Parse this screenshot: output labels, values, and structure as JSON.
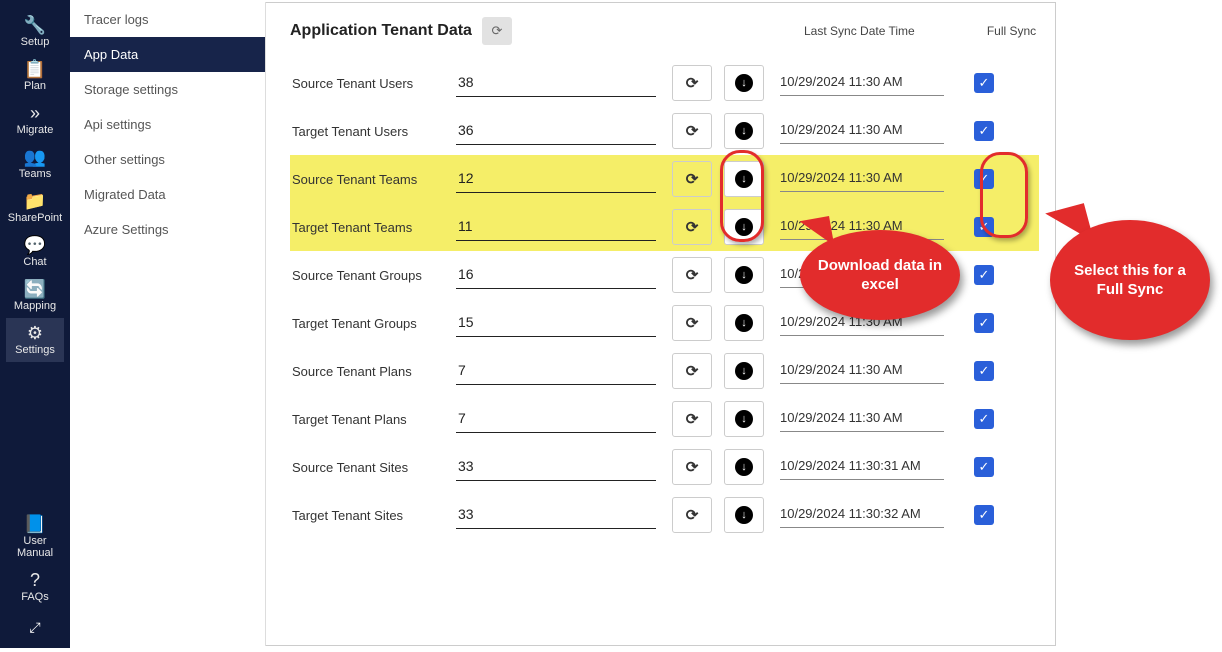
{
  "mainNav": {
    "items": [
      {
        "label": "Setup",
        "icon": "🔧"
      },
      {
        "label": "Plan",
        "icon": "📋"
      },
      {
        "label": "Migrate",
        "icon": "»"
      },
      {
        "label": "Teams",
        "icon": "👥"
      },
      {
        "label": "SharePoint",
        "icon": "📁"
      },
      {
        "label": "Chat",
        "icon": "💬"
      },
      {
        "label": "Mapping",
        "icon": "🔄"
      },
      {
        "label": "Settings",
        "icon": "⚙"
      }
    ],
    "bottom": [
      {
        "label": "User Manual",
        "icon": "📘"
      },
      {
        "label": "FAQs",
        "icon": "?"
      }
    ],
    "activeIndex": 7
  },
  "subNav": {
    "items": [
      "Tracer logs",
      "App Data",
      "Storage settings",
      "Api settings",
      "Other settings",
      "Migrated Data",
      "Azure Settings"
    ],
    "activeIndex": 1
  },
  "content": {
    "title": "Application Tenant Data",
    "colHeaders": {
      "lastSync": "Last Sync Date Time",
      "fullSync": "Full Sync"
    },
    "rows": [
      {
        "label": "Source Tenant Users",
        "value": "38",
        "date": "10/29/2024 11:30 AM",
        "checked": true,
        "highlight": false
      },
      {
        "label": "Target Tenant Users",
        "value": "36",
        "date": "10/29/2024 11:30 AM",
        "checked": true,
        "highlight": false
      },
      {
        "label": "Source Tenant Teams",
        "value": "12",
        "date": "10/29/2024 11:30 AM",
        "checked": true,
        "highlight": true
      },
      {
        "label": "Target Tenant Teams",
        "value": "11",
        "date": "10/29/2024 11:30 AM",
        "checked": true,
        "highlight": true
      },
      {
        "label": "Source Tenant Groups",
        "value": "16",
        "date": "10/29/2024 11:30 AM",
        "checked": true,
        "highlight": false
      },
      {
        "label": "Target Tenant Groups",
        "value": "15",
        "date": "10/29/2024 11:30 AM",
        "checked": true,
        "highlight": false
      },
      {
        "label": "Source Tenant Plans",
        "value": "7",
        "date": "10/29/2024 11:30 AM",
        "checked": true,
        "highlight": false
      },
      {
        "label": "Target Tenant Plans",
        "value": "7",
        "date": "10/29/2024 11:30 AM",
        "checked": true,
        "highlight": false
      },
      {
        "label": "Source Tenant Sites",
        "value": "33",
        "date": "10/29/2024 11:30:31 AM",
        "checked": true,
        "highlight": false
      },
      {
        "label": "Target Tenant Sites",
        "value": "33",
        "date": "10/29/2024 11:30:32 AM",
        "checked": true,
        "highlight": false
      }
    ]
  },
  "callouts": {
    "download": "Download data in excel",
    "fullsync": "Select this for a Full Sync"
  }
}
